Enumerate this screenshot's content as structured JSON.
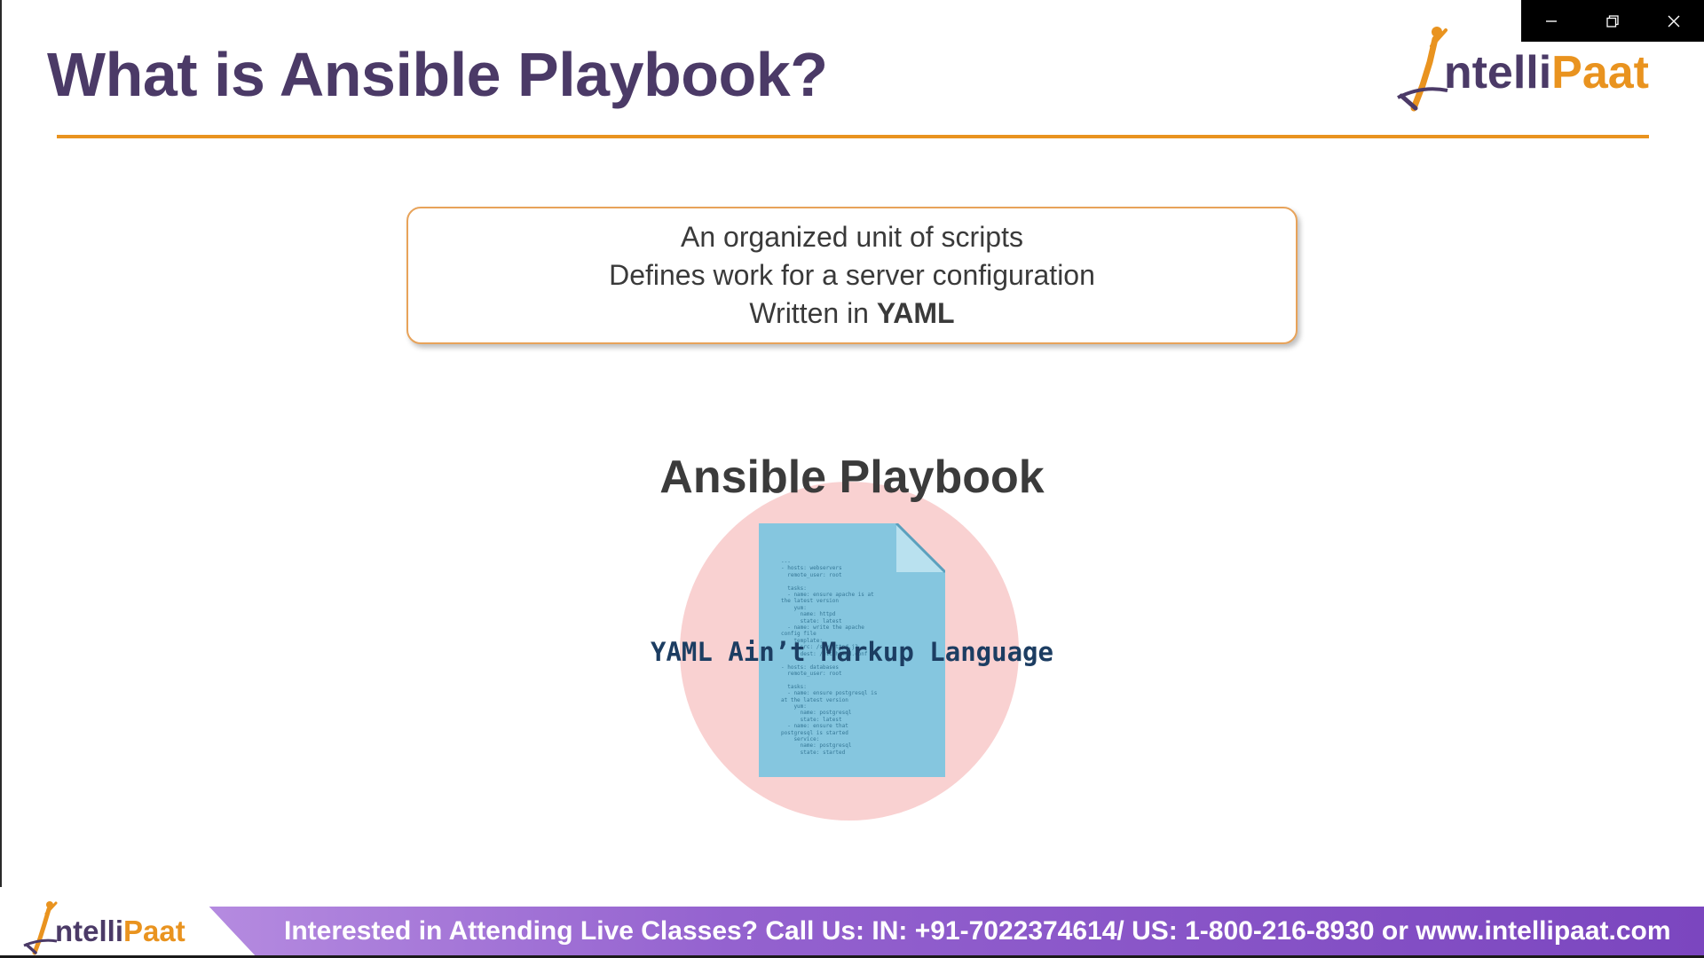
{
  "slide": {
    "title": "What is Ansible Playbook?",
    "info_lines": [
      "An organized unit of scripts",
      "Defines work for a server configuration"
    ],
    "written_in_prefix": "Written in ",
    "written_in_value": "YAML",
    "playbook_heading": "Ansible Playbook",
    "yaml_caption": "YAML Ain’t Markup Language",
    "code_snippet": "---\n- hosts: webservers\n  remote_user: root\n\n  tasks:\n  - name: ensure apache is at\nthe latest version\n    yum:\n      name: httpd\n      state: latest\n  - name: write the apache\nconfig file\n    template:\n      src: /srv/httpd.j2\n      dest: /etc/httpd.conf\n\n- hosts: databases\n  remote_user: root\n\n  tasks:\n  - name: ensure postgresql is\nat the latest version\n    yum:\n      name: postgresql\n      state: latest\n  - name: ensure that\npostgresql is started\n    service:\n      name: postgresql\n      state: started"
  },
  "brand": {
    "logo_intelli": "ntelli",
    "logo_paat": "Paat",
    "primary_color": "#4b3a67",
    "accent_color": "#e9931f"
  },
  "footer": {
    "text": "Interested in Attending Live Classes? Call Us: IN: +91-7022374614/ US: 1-800-216-8930 or www.intellipaat.com"
  },
  "window_controls": {
    "icons": [
      "minimize-icon",
      "restore-icon",
      "close-icon"
    ]
  }
}
